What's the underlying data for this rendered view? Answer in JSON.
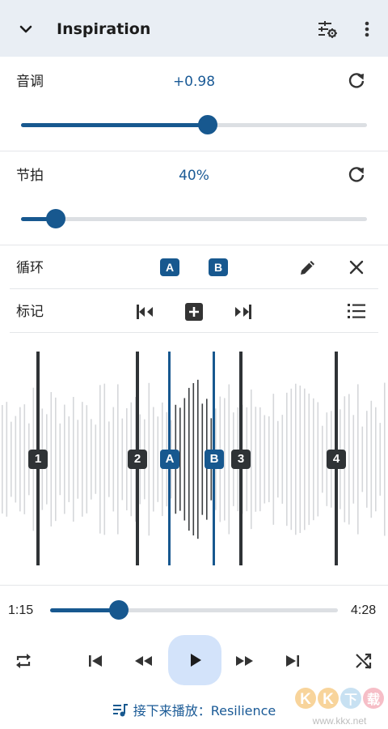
{
  "header": {
    "title": "Inspiration"
  },
  "pitch": {
    "label": "音调",
    "value": "+0.98",
    "level": 0.54
  },
  "tempo": {
    "label": "节拍",
    "value": "40%",
    "level": 0.1
  },
  "loop": {
    "label": "循环",
    "a_label": "A",
    "b_label": "B"
  },
  "markers": {
    "label": "标记",
    "items": [
      "1",
      "2",
      "3",
      "4"
    ],
    "loop_a": "A",
    "loop_b": "B"
  },
  "playback": {
    "current_time": "1:15",
    "total_time": "4:28",
    "progress": 0.24
  },
  "up_next": {
    "text": "接下来播放：Resilience"
  },
  "watermark": {
    "text": "KK下载",
    "url": "www.kkx.net"
  },
  "colors": {
    "accent": "#17588f",
    "header_bg": "#e9eef4",
    "play_bg": "#d3e3fa",
    "marker": "#2f3336"
  }
}
